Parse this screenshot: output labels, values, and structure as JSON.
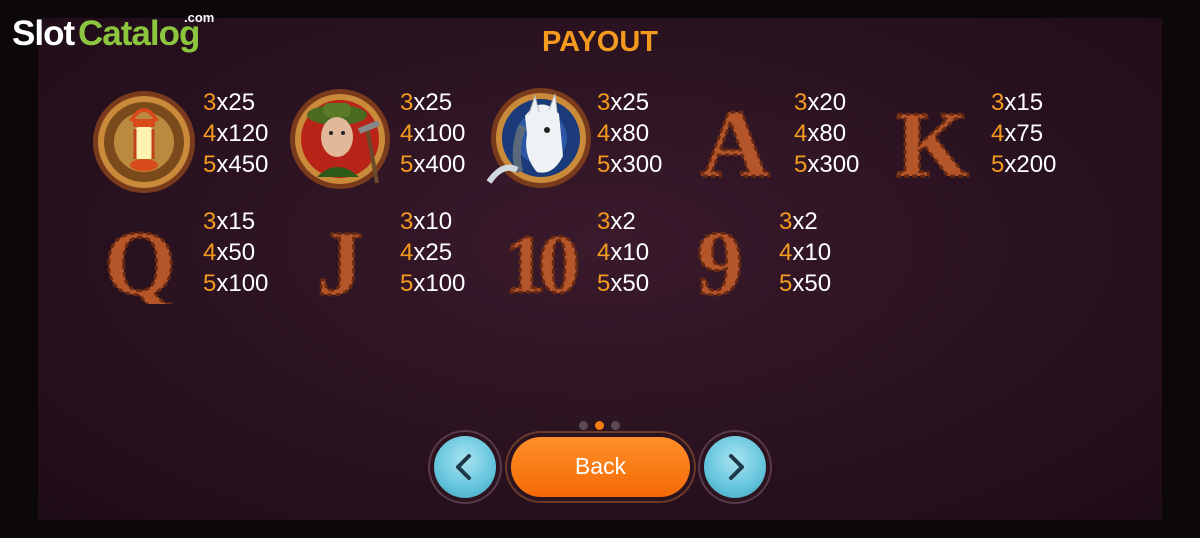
{
  "logo": {
    "part1": "Slot",
    "part2": "Catalog",
    "suffix": ".com"
  },
  "title": "PAYOUT",
  "symbols": [
    {
      "name": "lantern",
      "pays": [
        {
          "n": "3",
          "v": "x25"
        },
        {
          "n": "4",
          "v": "x120"
        },
        {
          "n": "5",
          "v": "x450"
        }
      ]
    },
    {
      "name": "prospector",
      "pays": [
        {
          "n": "3",
          "v": "x25"
        },
        {
          "n": "4",
          "v": "x100"
        },
        {
          "n": "5",
          "v": "x400"
        }
      ]
    },
    {
      "name": "horse",
      "pays": [
        {
          "n": "3",
          "v": "x25"
        },
        {
          "n": "4",
          "v": "x80"
        },
        {
          "n": "5",
          "v": "x300"
        }
      ]
    },
    {
      "name": "A",
      "letter": "A",
      "pays": [
        {
          "n": "3",
          "v": "x20"
        },
        {
          "n": "4",
          "v": "x80"
        },
        {
          "n": "5",
          "v": "x300"
        }
      ]
    },
    {
      "name": "K",
      "letter": "K",
      "pays": [
        {
          "n": "3",
          "v": "x15"
        },
        {
          "n": "4",
          "v": "x75"
        },
        {
          "n": "5",
          "v": "x200"
        }
      ]
    },
    {
      "name": "Q",
      "letter": "Q",
      "pays": [
        {
          "n": "3",
          "v": "x15"
        },
        {
          "n": "4",
          "v": "x50"
        },
        {
          "n": "5",
          "v": "x100"
        }
      ]
    },
    {
      "name": "J",
      "letter": "J",
      "pays": [
        {
          "n": "3",
          "v": "x10"
        },
        {
          "n": "4",
          "v": "x25"
        },
        {
          "n": "5",
          "v": "x100"
        }
      ]
    },
    {
      "name": "10",
      "letter": "10",
      "pays": [
        {
          "n": "3",
          "v": "x2"
        },
        {
          "n": "4",
          "v": "x10"
        },
        {
          "n": "5",
          "v": "x50"
        }
      ]
    },
    {
      "name": "9",
      "letter": "9",
      "pays": [
        {
          "n": "3",
          "v": "x2"
        },
        {
          "n": "4",
          "v": "x10"
        },
        {
          "n": "5",
          "v": "x50"
        }
      ]
    }
  ],
  "pagination": {
    "pages": 3,
    "active": 2
  },
  "buttons": {
    "back": "Back",
    "prev_icon": "chevron-left-icon",
    "next_icon": "chevron-right-icon"
  },
  "colors": {
    "accent": "#f49a1e",
    "button_orange": "#f46a06",
    "button_blue": "#63c4dc",
    "letter_brown": "#b5562a"
  }
}
